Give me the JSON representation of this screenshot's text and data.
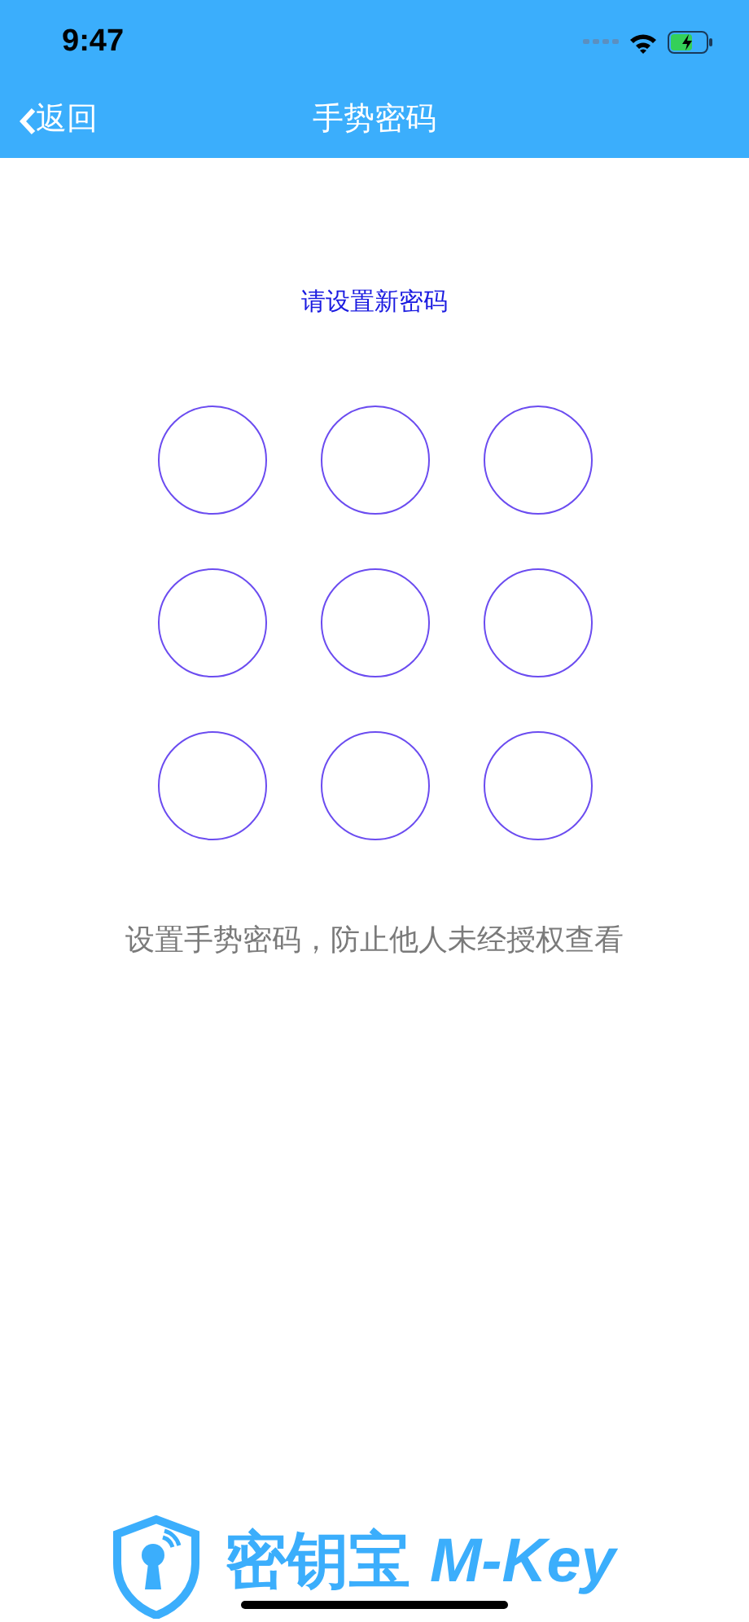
{
  "status_bar": {
    "time": "9:47"
  },
  "nav_bar": {
    "back": "返回",
    "title": "手势密码"
  },
  "prompt": "请设置新密码",
  "gesture_grid": [
    {
      "selected": false
    },
    {
      "selected": false
    },
    {
      "selected": false
    },
    {
      "selected": false
    },
    {
      "selected": false
    },
    {
      "selected": false
    },
    {
      "selected": false
    },
    {
      "selected": false
    },
    {
      "selected": false
    }
  ],
  "hint": "设置手势密码，防止他人未经授权查看",
  "footer_logo": {
    "name": "密钥宝",
    "latin": "M-Key"
  }
}
